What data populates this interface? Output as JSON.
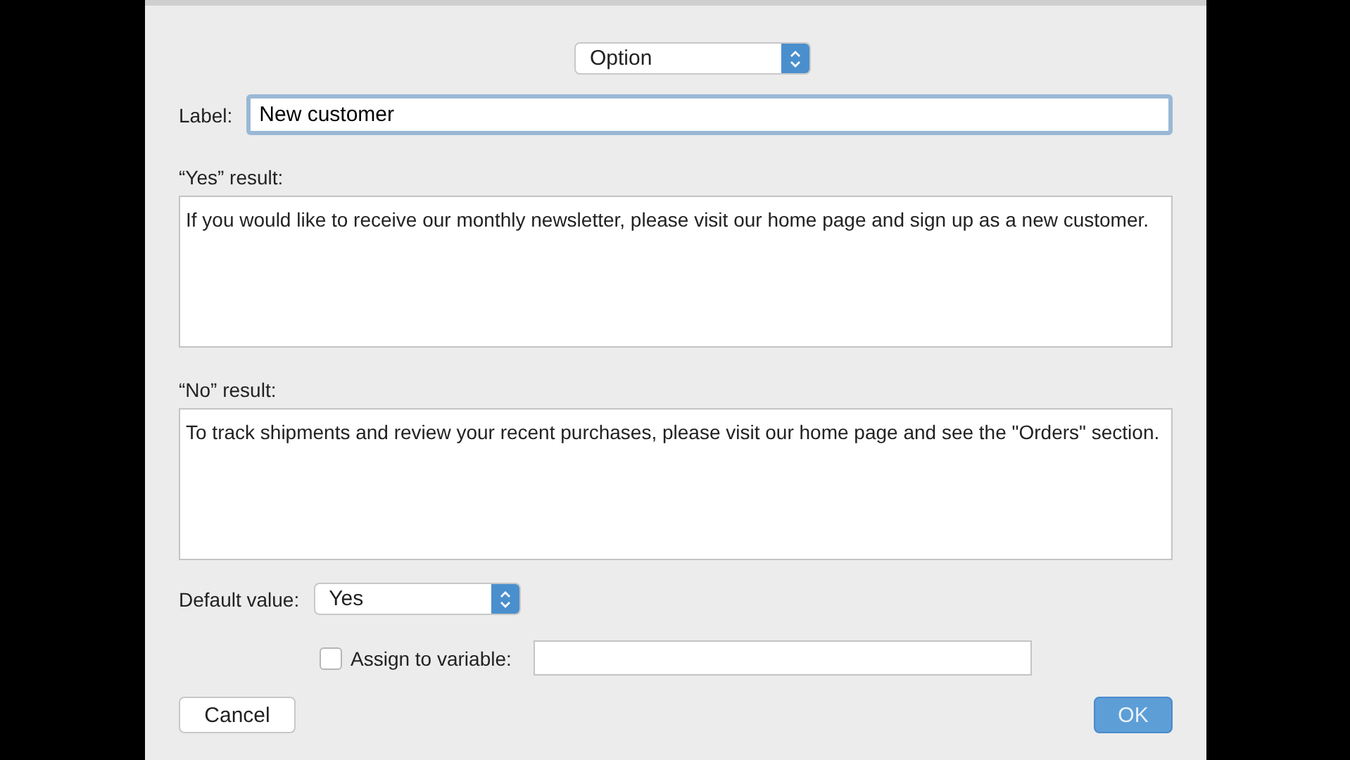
{
  "type_popup": {
    "value": "Option"
  },
  "label_field": {
    "label": "Label:",
    "value": "New customer",
    "focused": true
  },
  "yes_result": {
    "label": "“Yes” result:",
    "value": "If you would like to receive our monthly newsletter, please visit our home page and sign up as a new customer."
  },
  "no_result": {
    "label": "“No” result:",
    "value": "To track shipments and review your recent purchases, please visit our home page and see the \"Orders\" section."
  },
  "default_value": {
    "label": "Default value:",
    "value": "Yes"
  },
  "assign": {
    "label": "Assign to variable:",
    "checked": false
  },
  "buttons": [
    {
      "label": "Cancel",
      "kind": "normal"
    },
    {
      "label": "OK",
      "kind": "default"
    }
  ]
}
